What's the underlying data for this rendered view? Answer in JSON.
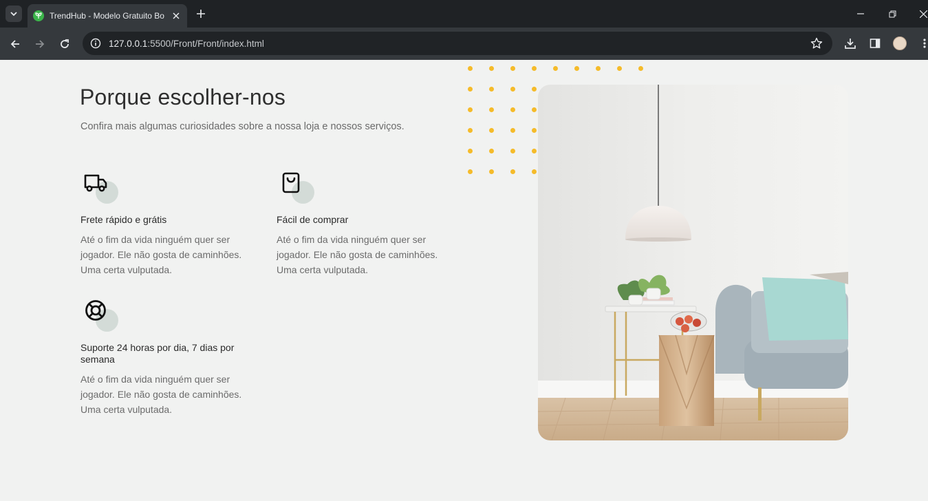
{
  "browser": {
    "tab_title": "TrendHub - Modelo Gratuito Bo",
    "url_host": "127.0.0.1",
    "url_path": ":5500/Front/Front/index.html"
  },
  "icons": {
    "tab_search": "chevron-down-icon",
    "favicon": "leaf-icon",
    "close": "close-icon",
    "new_tab": "plus-icon",
    "back": "arrow-left-icon",
    "forward": "arrow-right-icon",
    "reload": "reload-icon",
    "site_info": "info-icon",
    "bookmark": "star-icon",
    "download": "download-icon",
    "side_panel": "side-panel-icon",
    "menu": "kebab-menu-icon"
  },
  "section": {
    "title": "Porque escolher-nos",
    "subtitle": "Confira mais algumas curiosidades sobre a nossa loja e nossos serviços."
  },
  "features": [
    {
      "icon": "truck-icon",
      "title": "Frete rápido e grátis",
      "text": "Até o fim da vida ninguém quer ser jogador. Ele não gosta de caminhões. Uma certa vulputada."
    },
    {
      "icon": "shopping-bag-icon",
      "title": "Fácil de comprar",
      "text": "Até o fim da vida ninguém quer ser jogador. Ele não gosta de caminhões. Uma certa vulputada."
    },
    {
      "icon": "lifebuoy-icon",
      "title": "Suporte 24 horas por dia, 7 dias por semana",
      "text": "Até o fim da vida ninguém quer ser jogador. Ele não gosta de caminhões. Uma certa vulputada."
    }
  ],
  "colors": {
    "accent_dots": "#f5bb2a",
    "icon_bubble": "#d3dbd7",
    "page_bg": "#f1f2f1"
  }
}
